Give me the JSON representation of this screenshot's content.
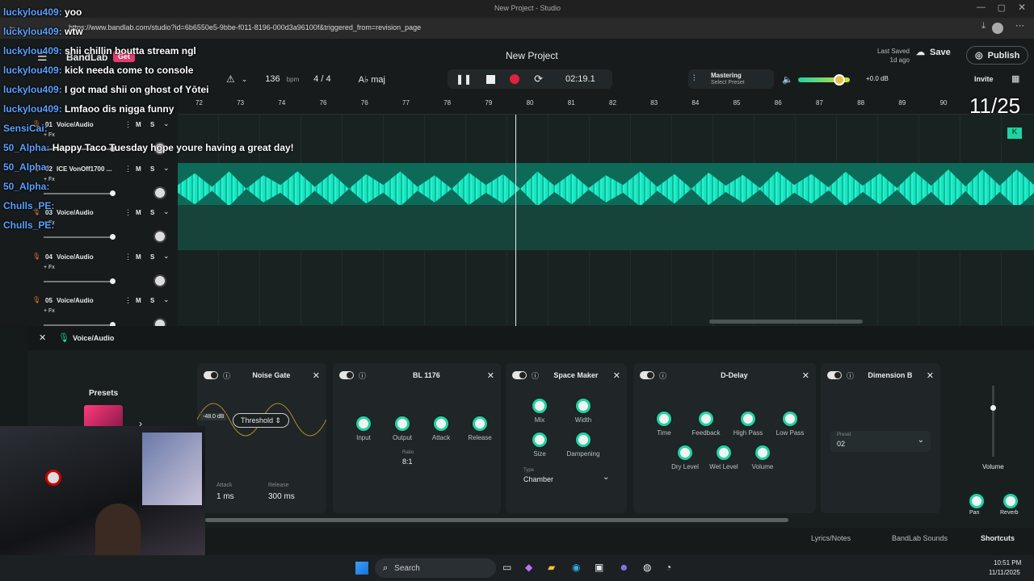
{
  "browser": {
    "title": "New Project - Studio",
    "url": "https://www.bandlab.com/studio?id=6b6550e5-9bbe-f011-8196-000d3a96100f&triggered_from=revision_page"
  },
  "app": {
    "logo": "BandLab",
    "get_badge": "Get",
    "project_title": "New Project",
    "last_saved_label": "Last Saved",
    "last_saved_value": "1d ago",
    "save": "Save",
    "publish": "Publish",
    "invite": "Invite"
  },
  "transport": {
    "bpm": "136",
    "bpm_unit": "bpm",
    "time_sig": "4 / 4",
    "key": "A♭ maj",
    "position": "02:19.1",
    "mastering": "Mastering",
    "mastering_sub": "Select Preset",
    "volume_db": "+0.0 dB",
    "volume_level": 0.8
  },
  "ruler": [
    "72",
    "73",
    "74",
    "76",
    "76",
    "77",
    "78",
    "79",
    "80",
    "81",
    "82",
    "83",
    "84",
    "85",
    "86",
    "87",
    "88",
    "89",
    "90"
  ],
  "overlay_time": "11/25",
  "tracks": [
    {
      "num": "01",
      "name": "Voice/Audio"
    },
    {
      "num": "02",
      "name": "ICE VonOff1700 ..."
    },
    {
      "num": "03",
      "name": "Voice/Audio"
    },
    {
      "num": "04",
      "name": "Voice/Audio"
    },
    {
      "num": "05",
      "name": "Voice/Audio"
    }
  ],
  "track_buttons": {
    "fx": "+ Fx",
    "mute": "M",
    "solo": "S"
  },
  "chat": [
    {
      "user": "luckylou409:",
      "msg": "yoo"
    },
    {
      "user": "luckylou409:",
      "msg": "wtw"
    },
    {
      "user": "luckylou409:",
      "msg": "shii chillin boutta stream ngl"
    },
    {
      "user": "luckylou409:",
      "msg": "kick needa come to console"
    },
    {
      "user": "luckylou409:",
      "msg": "I got mad shii on ghost of Yōtei"
    },
    {
      "user": "luckylou409:",
      "msg": "Lmfaoo dis nigga funny"
    },
    {
      "user": "SensiCai:",
      "msg": ""
    },
    {
      "user": "50_Alpha:",
      "msg": "Happy Taco Tuesday hope youre having a great day!"
    },
    {
      "user": "50_Alpha:",
      "msg": ""
    },
    {
      "user": "50_Alpha:",
      "msg": ""
    },
    {
      "user": "Chulls_PE:",
      "msg": ""
    },
    {
      "user": "Chulls_PE:",
      "msg": ""
    }
  ],
  "fx": {
    "track_label": "Voice/Audio",
    "presets": "Presets",
    "noise_gate": {
      "title": "Noise Gate",
      "db": "-48.0 dB",
      "threshold": "Threshold",
      "attack_label": "Attack",
      "attack": "1 ms",
      "release_label": "Release",
      "release": "300 ms"
    },
    "bl1176": {
      "title": "BL 1176",
      "knobs": [
        "Input",
        "Output",
        "Attack",
        "Release"
      ],
      "ratio_label": "Ratio",
      "ratio": "8:1"
    },
    "space_maker": {
      "title": "Space Maker",
      "knobs": [
        "Mix",
        "Width",
        "Size",
        "Dampening"
      ],
      "type_label": "Type",
      "type": "Chamber"
    },
    "d_delay": {
      "title": "D-Delay",
      "knobs": [
        "Time",
        "Feedback",
        "High Pass",
        "Low Pass",
        "Dry Level",
        "Wet Level",
        "Volume"
      ]
    },
    "dimension": {
      "title": "Dimension B",
      "preset_label": "Preset",
      "preset": "02"
    },
    "master": {
      "volume": "Volume",
      "pan": "Pan",
      "reverb": "Reverb"
    }
  },
  "status": {
    "lyrics": "Lyrics/Notes",
    "sounds": "BandLab Sounds",
    "shortcuts": "Shortcuts"
  },
  "taskbar": {
    "search": "Search",
    "time": "10:51 PM",
    "date": "11/11/2025"
  },
  "colors": {
    "accent": "#1fd3a4",
    "record": "#e0223a",
    "wave": "#19e5c0"
  }
}
